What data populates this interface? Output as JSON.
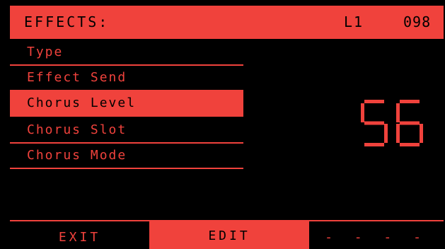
{
  "header": {
    "title": "EFFECTS:",
    "patch": "L1",
    "patch_number": "098"
  },
  "menu": {
    "items": [
      {
        "label": "Type"
      },
      {
        "label": "Effect Send"
      },
      {
        "label": "Chorus Level"
      },
      {
        "label": "Chorus Slot"
      },
      {
        "label": "Chorus Mode"
      }
    ],
    "selected_index": 2
  },
  "value_display": {
    "value": "56"
  },
  "footer": {
    "exit_label": "EXIT",
    "edit_label": "EDIT",
    "blank_label": "- - - -"
  },
  "colors": {
    "accent": "#f0423c",
    "background": "#000000"
  }
}
